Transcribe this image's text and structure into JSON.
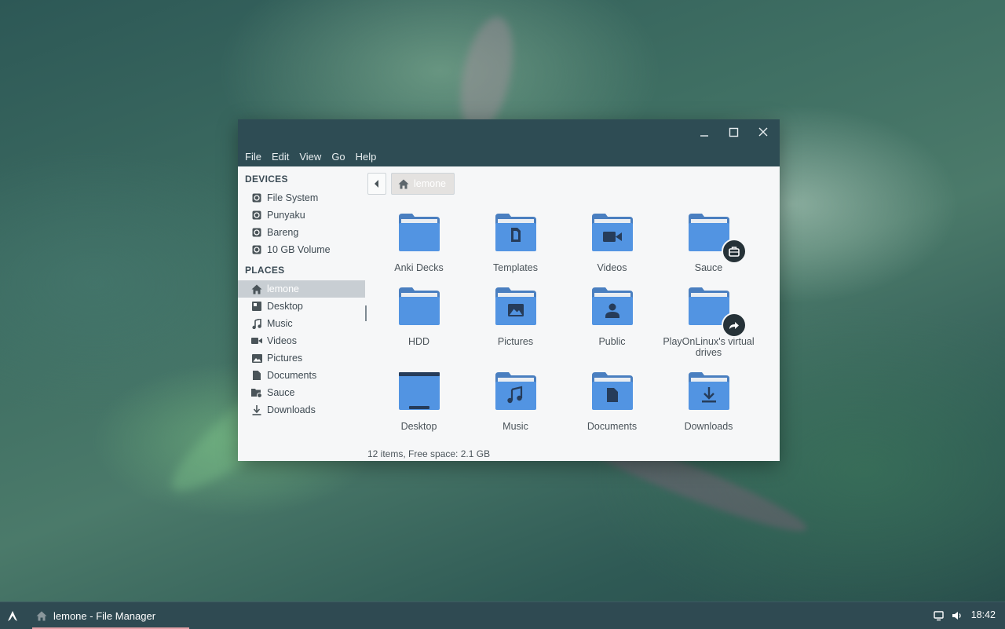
{
  "window": {
    "menu": [
      "File",
      "Edit",
      "View",
      "Go",
      "Help"
    ]
  },
  "sidebar": {
    "devices_title": "DEVICES",
    "devices": [
      {
        "label": "File System",
        "icon": "drive-icon"
      },
      {
        "label": "Punyaku",
        "icon": "drive-icon"
      },
      {
        "label": "Bareng",
        "icon": "drive-icon"
      },
      {
        "label": "10 GB Volume",
        "icon": "drive-icon"
      }
    ],
    "places_title": "PLACES",
    "places": [
      {
        "label": "lemone",
        "icon": "home-icon",
        "active": true
      },
      {
        "label": "Desktop",
        "icon": "desktop-icon"
      },
      {
        "label": "Music",
        "icon": "music-icon"
      },
      {
        "label": "Videos",
        "icon": "video-icon"
      },
      {
        "label": "Pictures",
        "icon": "picture-icon"
      },
      {
        "label": "Documents",
        "icon": "document-icon"
      },
      {
        "label": "Sauce",
        "icon": "shared-folder-icon"
      },
      {
        "label": "Downloads",
        "icon": "download-icon"
      }
    ]
  },
  "path": {
    "crumb": "lemone"
  },
  "files": [
    {
      "label": "Anki Decks",
      "icon": "folder"
    },
    {
      "label": "Templates",
      "icon": "folder-templates"
    },
    {
      "label": "Videos",
      "icon": "folder-videos"
    },
    {
      "label": "Sauce",
      "icon": "folder-shared"
    },
    {
      "label": "HDD",
      "icon": "folder"
    },
    {
      "label": "Pictures",
      "icon": "folder-pictures"
    },
    {
      "label": "Public",
      "icon": "folder-public"
    },
    {
      "label": "PlayOnLinux's virtual drives",
      "icon": "folder-link"
    },
    {
      "label": "Desktop",
      "icon": "folder-desktop"
    },
    {
      "label": "Music",
      "icon": "folder-music"
    },
    {
      "label": "Documents",
      "icon": "folder-documents"
    },
    {
      "label": "Downloads",
      "icon": "folder-downloads"
    }
  ],
  "status": "12 items, Free space: 2.1 GB",
  "taskbar": {
    "task_label": "lemone - File Manager",
    "clock": "18:42"
  },
  "colors": {
    "folder": "#5294e2",
    "folder_tab": "#4a7fc0",
    "glyph": "#263c5a",
    "chrome": "#2e4c54",
    "taskbar": "#2f4a52"
  }
}
